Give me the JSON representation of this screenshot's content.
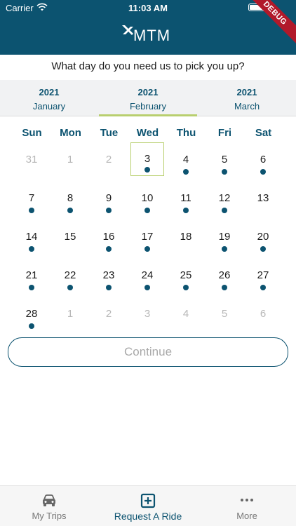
{
  "status": {
    "carrier": "Carrier",
    "time": "11:03 AM"
  },
  "debug_banner": "DEBUG",
  "brand": {
    "logo_text": "MTM"
  },
  "prompt": "What day do you need us to pick you up?",
  "months": [
    {
      "year": "2021",
      "name": "January"
    },
    {
      "year": "2021",
      "name": "February"
    },
    {
      "year": "2021",
      "name": "March"
    }
  ],
  "weekdays": [
    "Sun",
    "Mon",
    "Tue",
    "Wed",
    "Thu",
    "Fri",
    "Sat"
  ],
  "days": {
    "r0": [
      "31",
      "1",
      "2",
      "3",
      "4",
      "5",
      "6"
    ],
    "r1": [
      "7",
      "8",
      "9",
      "10",
      "11",
      "12",
      "13"
    ],
    "r2": [
      "14",
      "15",
      "16",
      "17",
      "18",
      "19",
      "20"
    ],
    "r3": [
      "21",
      "22",
      "23",
      "24",
      "25",
      "26",
      "27"
    ],
    "r4": [
      "28",
      "1",
      "2",
      "3",
      "4",
      "5",
      "6"
    ]
  },
  "selected_day": "3",
  "continue_label": "Continue",
  "tabs": [
    {
      "label": "My Trips",
      "icon": "car-icon"
    },
    {
      "label": "Request A Ride",
      "icon": "plus-square-icon"
    },
    {
      "label": "More",
      "icon": "more-dots-icon"
    }
  ],
  "colors": {
    "brand": "#0c5370",
    "accent": "#b8cf6e",
    "muted": "#b7b7b7"
  }
}
